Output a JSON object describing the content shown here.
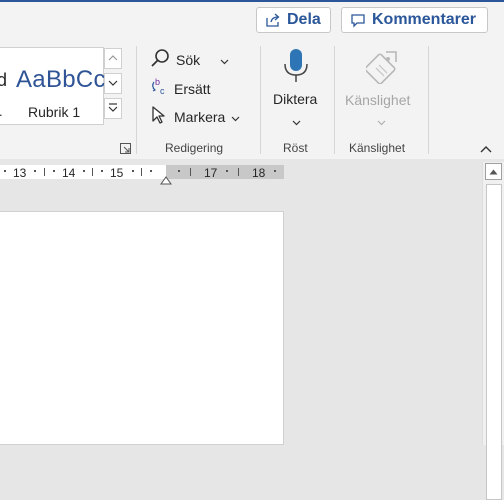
{
  "header": {
    "share_label": "Dela",
    "comments_label": "Kommentarer",
    "accent_color": "#2b579a"
  },
  "ribbon": {
    "styles": {
      "sample_partial": "d",
      "name_partial": ".",
      "sample_heading": "AaBbCc",
      "heading_name": "Rubrik 1"
    },
    "editing": {
      "find_label": "Sök",
      "replace_label": "Ersätt",
      "select_label": "Markera",
      "group_label": "Redigering"
    },
    "voice": {
      "dictate_label": "Diktera",
      "group_label": "Röst"
    },
    "sensitivity": {
      "button_label": "Känslighet",
      "group_label": "Känslighet"
    }
  },
  "ruler": {
    "numbers": [
      "13",
      "14",
      "15",
      "17",
      "18"
    ]
  }
}
